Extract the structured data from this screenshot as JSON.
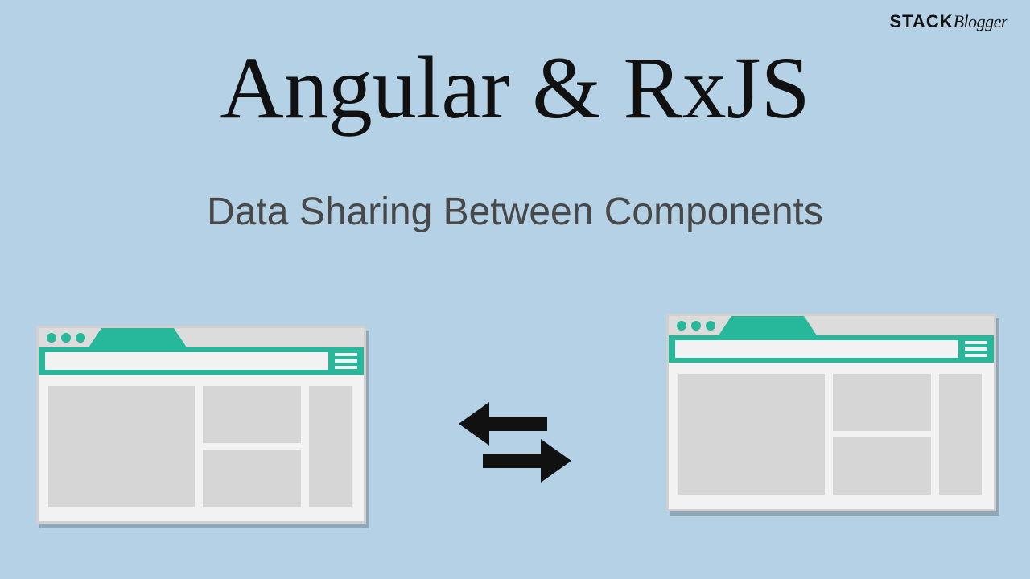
{
  "logo": {
    "stack": "STACK",
    "blogger": "Blogger"
  },
  "title": "Angular & RxJS",
  "subtitle": "Data Sharing Between Components",
  "colors": {
    "background": "#b4d1e5",
    "accent": "#27b79a",
    "text_dark": "#111111",
    "text_muted": "#484848",
    "window_fill": "#dcdcdc",
    "block_fill": "#d6d6d6"
  },
  "icons": {
    "left_browser": "browser-window-icon",
    "right_browser": "browser-window-icon",
    "exchange": "exchange-arrows-icon"
  }
}
